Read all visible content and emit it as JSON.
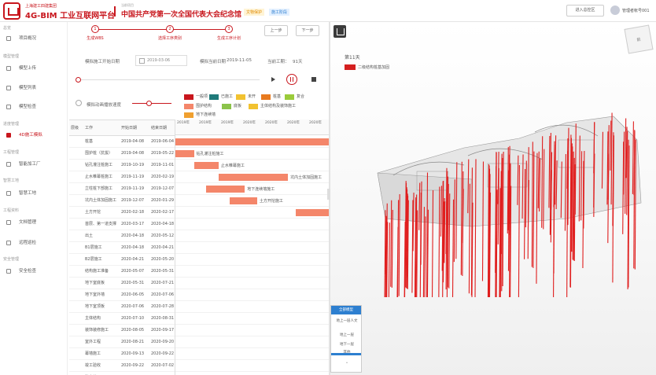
{
  "header": {
    "brand_sub": "上海建工四建集团",
    "brand": "4G-BIM 工业互联网平台",
    "project_sub": "当前项目",
    "project": "中国共产党第一次全国代表大会纪念馆",
    "tag_status": "文物保护",
    "tag_type": "施工阶段",
    "switch_button": "进入总控区",
    "user": "管理者帐号001"
  },
  "sidebar": {
    "sections": [
      {
        "title": "总览",
        "items": [
          "项目概况"
        ]
      },
      {
        "title": "模型管理",
        "items": [
          "模型上传",
          "模型列表",
          "模型检查"
        ]
      },
      {
        "title": "进度管理",
        "items": [
          "4D施工模拟"
        ]
      },
      {
        "title": "工程管理",
        "items": [
          "智能加工厂"
        ]
      },
      {
        "title": "智慧工地",
        "items": [
          "智慧工地"
        ]
      },
      {
        "title": "工程资料",
        "items": [
          "文档管理"
        ]
      },
      {
        "title": "",
        "items": [
          "远程巡检"
        ]
      },
      {
        "title": "安全管理",
        "items": [
          "安全检查"
        ]
      }
    ],
    "active": "4D施工模拟"
  },
  "steps": {
    "items": [
      {
        "num": "1",
        "label": "生成WBS"
      },
      {
        "num": "2",
        "label": "选择工序类别"
      },
      {
        "num": "3",
        "label": "生成工序计划"
      }
    ],
    "prev": "上一步",
    "next": "下一步"
  },
  "simulation": {
    "start_label": "模拟施工开始日期",
    "start_value": "2019-03-06",
    "current_label": "模拟当前日期",
    "current_value": "2019-11-05",
    "days_label": "当前工期：",
    "days_value": "91天",
    "speed_label": "模拟动画播放速度"
  },
  "legend": [
    {
      "label": "一般项",
      "color": "#c8161d"
    },
    {
      "label": "已施工",
      "color": "#1f7a7a"
    },
    {
      "label": "未开",
      "color": "#f2c230"
    },
    {
      "label": "桩基",
      "color": "#e87a1f"
    },
    {
      "label": "复合",
      "color": "#9acb3a"
    },
    {
      "label": "支撑",
      "color": "#f4866a"
    },
    {
      "label": "围护结构",
      "color": "#f4866a"
    },
    {
      "label": "底板",
      "color": "#8bc34a"
    },
    {
      "label": "主体结构及装饰施工",
      "color": "#f2c230"
    },
    {
      "label": "地下连续墙",
      "color": "#f0a030"
    }
  ],
  "table": {
    "headers": [
      "层级",
      "工作",
      "开始日期",
      "结束日期"
    ],
    "rows": [
      {
        "level": "",
        "name": "桩基",
        "start": "2019-04-08",
        "end": "2019-06-04"
      },
      {
        "level": "",
        "name": "围护桩（抗拔）",
        "start": "2019-04-08",
        "end": "2019-05-22"
      },
      {
        "level": "",
        "name": "钻孔灌注桩施工",
        "start": "2019-10-19",
        "end": "2019-11-01"
      },
      {
        "level": "",
        "name": "止水帷幕桩施工",
        "start": "2019-11-19",
        "end": "2020-02-19"
      },
      {
        "level": "",
        "name": "立柱桩下部施工",
        "start": "2019-11-19",
        "end": "2019-12-07"
      },
      {
        "level": "",
        "name": "坑内土体加固施工",
        "start": "2019-12-07",
        "end": "2020-01-29"
      },
      {
        "level": "",
        "name": "土方开挖",
        "start": "2020-02-18",
        "end": "2020-02-17"
      },
      {
        "level": "",
        "name": "首层、第一道支撑",
        "start": "2020-03-17",
        "end": "2020-04-18"
      },
      {
        "level": "",
        "name": "出土",
        "start": "2020-04-18",
        "end": "2020-05-12"
      },
      {
        "level": "",
        "name": "B1层施工",
        "start": "2020-04-18",
        "end": "2020-04-21"
      },
      {
        "level": "",
        "name": "B2层施工",
        "start": "2020-04-21",
        "end": "2020-05-20"
      },
      {
        "level": "",
        "name": "结构施工准备",
        "start": "2020-05-07",
        "end": "2020-05-31"
      },
      {
        "level": "",
        "name": "地下室底板",
        "start": "2020-05-31",
        "end": "2020-07-21"
      },
      {
        "level": "",
        "name": "地下室外墙",
        "start": "2020-06-05",
        "end": "2020-07-06"
      },
      {
        "level": "",
        "name": "地下室顶板",
        "start": "2020-07-06",
        "end": "2020-07-28"
      },
      {
        "level": "",
        "name": "主体结构",
        "start": "2020-07-10",
        "end": "2020-08-31"
      },
      {
        "level": "",
        "name": "装饰装修施工",
        "start": "2020-08-05",
        "end": "2020-09-17"
      },
      {
        "level": "",
        "name": "室外工程",
        "start": "2020-08-21",
        "end": "2020-09-20"
      },
      {
        "level": "",
        "name": "幕墙施工",
        "start": "2020-09-13",
        "end": "2020-09-22"
      },
      {
        "level": "",
        "name": "竣工验收",
        "start": "2020-09-22",
        "end": "2020-07-02"
      },
      {
        "level": "",
        "name": "移交使用",
        "start": "2020-09-22",
        "end": "2020-07-02"
      }
    ]
  },
  "gantt": {
    "months": [
      "2019年",
      "2019年",
      "2019年",
      "2020年",
      "2020年",
      "2020年",
      "2020年"
    ],
    "bars": [
      {
        "row": 0,
        "start": 0.0,
        "len": 1.0,
        "label": ""
      },
      {
        "row": 1,
        "start": 0.0,
        "len": 0.12,
        "label": "钻孔灌注桩施工"
      },
      {
        "row": 2,
        "start": 0.12,
        "len": 0.16,
        "label": "止水帷幕施工"
      },
      {
        "row": 3,
        "start": 0.28,
        "len": 0.45,
        "label": "坑内土体加固施工"
      },
      {
        "row": 4,
        "start": 0.2,
        "len": 0.25,
        "label": "地下连续墙施工"
      },
      {
        "row": 5,
        "start": 0.35,
        "len": 0.18,
        "label": "土方开挖施工"
      },
      {
        "row": 6,
        "start": 0.78,
        "len": 0.22,
        "label": ""
      }
    ]
  },
  "viewer": {
    "day": "第11天",
    "legend_label": "二级结构桩基加固",
    "legend_color": "#d41f1f",
    "cube_face": "前",
    "panel": {
      "title": "全部模型",
      "items": [
        "地上一层人文",
        "地上一层",
        "地下一层",
        "其他"
      ]
    }
  }
}
